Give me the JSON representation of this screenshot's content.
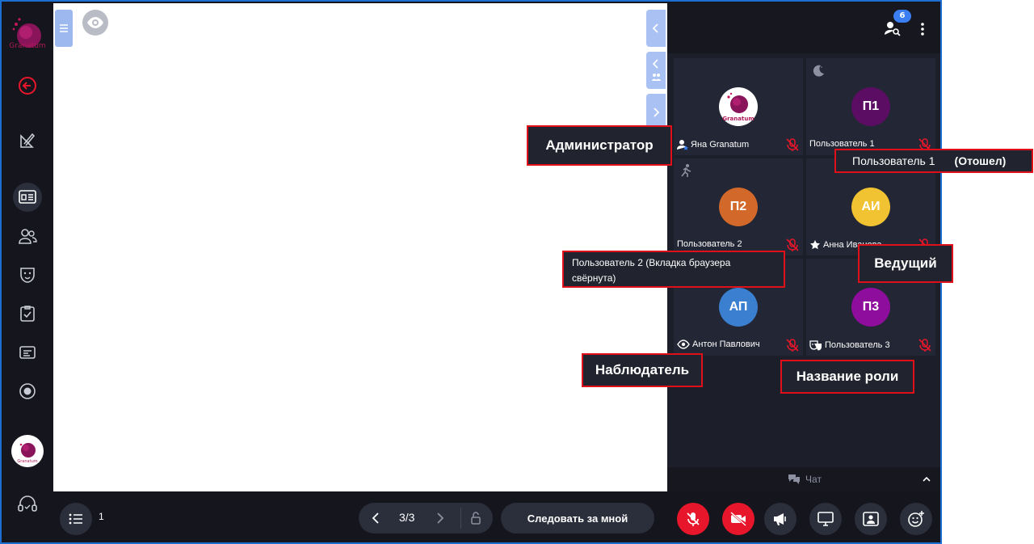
{
  "colors": {
    "accent_blue": "#3b7ef2",
    "danger_red": "#e8162b",
    "callout_border": "#e0101a",
    "brand": "#b0185a"
  },
  "sidebar": {
    "logo_text": "Granatum",
    "items": [
      {
        "icon": "back-arrow-icon"
      },
      {
        "icon": "pencil-ruler-icon"
      },
      {
        "icon": "presentation-icon",
        "active": true
      },
      {
        "icon": "users-icon"
      },
      {
        "icon": "theater-mask-icon"
      },
      {
        "icon": "checklist-icon"
      },
      {
        "icon": "subtitles-icon"
      },
      {
        "icon": "record-icon"
      },
      {
        "icon": "profile-avatar-icon"
      },
      {
        "icon": "support-headset-icon"
      }
    ]
  },
  "panel": {
    "participants_count": "6",
    "chat_label": "Чат"
  },
  "participants": [
    {
      "name": "Яна Granatum",
      "avatar": "",
      "role_icon": "admin-icon",
      "color": "#ffffff",
      "logo": true
    },
    {
      "name": "Пользователь 1",
      "avatar": "П1",
      "role_icon": "",
      "corner_icon": "moon-icon",
      "color": "#5b0d63"
    },
    {
      "name": "Пользователь 2",
      "avatar": "П2",
      "role_icon": "",
      "corner_icon": "running-person-icon",
      "color": "#d2692a"
    },
    {
      "name": "Анна Иванова",
      "avatar": "АИ",
      "role_icon": "star-icon",
      "color": "#f1c232"
    },
    {
      "name": "Антон Павлович",
      "avatar": "АП",
      "role_icon": "eye-icon",
      "color": "#3b7fd1"
    },
    {
      "name": "Пользователь 3",
      "avatar": "П3",
      "role_icon": "mask-icon",
      "color": "#8e0d9c"
    }
  ],
  "bottom": {
    "slide_count": "1",
    "pager": "3/3",
    "follow_label": "Следовать за мной"
  },
  "callouts": {
    "admin": "Администратор",
    "presenter": "Ведущий",
    "observer": "Наблюдатель",
    "role_name": "Название роли",
    "user1_name": "Пользователь 1",
    "user1_status": "(Отошел)",
    "user2_tooltip": "Пользователь 2 (Вкладка браузера свёрнута)"
  }
}
